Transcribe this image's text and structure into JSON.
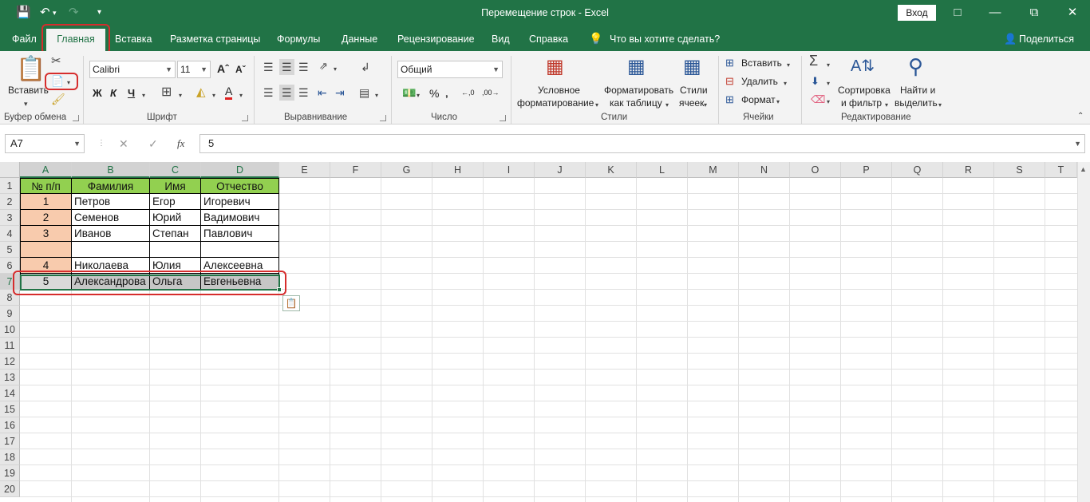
{
  "titlebar": {
    "title": "Перемещение строк  -  Excel",
    "login_label": "Вход"
  },
  "menu": {
    "tabs": [
      "Файл",
      "Главная",
      "Вставка",
      "Разметка страницы",
      "Формулы",
      "Данные",
      "Рецензирование",
      "Вид",
      "Справка"
    ],
    "tell_me": "Что вы хотите сделать?",
    "share": "Поделиться"
  },
  "ribbon": {
    "clipboard": {
      "paste": "Вставить",
      "label": "Буфер обмена"
    },
    "font": {
      "name": "Calibri",
      "size": "11",
      "bold": "Ж",
      "italic": "К",
      "underline": "Ч",
      "label": "Шрифт"
    },
    "alignment": {
      "label": "Выравнивание"
    },
    "number": {
      "format": "Общий",
      "label": "Число"
    },
    "styles": {
      "conditional": [
        "Условное",
        "форматирование"
      ],
      "as_table": [
        "Форматировать",
        "как таблицу"
      ],
      "cell_styles": [
        "Стили",
        "ячеек"
      ],
      "label": "Стили"
    },
    "cells": {
      "insert": "Вставить",
      "delete": "Удалить",
      "format": "Формат",
      "label": "Ячейки"
    },
    "editing": {
      "sort": [
        "Сортировка",
        "и фильтр"
      ],
      "find": [
        "Найти и",
        "выделить"
      ],
      "label": "Редактирование"
    }
  },
  "formula_bar": {
    "name_box": "A7",
    "fx": "fx",
    "value": "5"
  },
  "grid": {
    "columns": [
      "A",
      "B",
      "C",
      "D",
      "E",
      "F",
      "G",
      "H",
      "I",
      "J",
      "K",
      "L",
      "M",
      "N",
      "O",
      "P",
      "Q",
      "R",
      "S",
      "T"
    ],
    "rows": [
      "1",
      "2",
      "3",
      "4",
      "5",
      "6",
      "7",
      "8",
      "9",
      "10",
      "11",
      "12",
      "13",
      "14",
      "15",
      "16",
      "17",
      "18",
      "19",
      "20"
    ],
    "table": [
      [
        "№ п/п",
        "Фамилия",
        "Имя",
        "Отчество"
      ],
      [
        "1",
        "Петров",
        "Егор",
        "Игоревич"
      ],
      [
        "2",
        "Семенов",
        "Юрий",
        "Вадимович"
      ],
      [
        "3",
        "Иванов",
        "Степан",
        "Павлович"
      ],
      [
        "",
        "",
        "",
        ""
      ],
      [
        "4",
        "Николаева",
        "Юлия",
        "Алексеевна"
      ],
      [
        "5",
        "Александрова",
        "Ольга",
        "Евгеньевна"
      ]
    ],
    "selected_row": 7,
    "active_cell": "A7"
  },
  "colors": {
    "accent": "#217346",
    "header_fill": "#92d050",
    "number_fill": "#f8cbad",
    "highlight": "#d62d2d"
  }
}
